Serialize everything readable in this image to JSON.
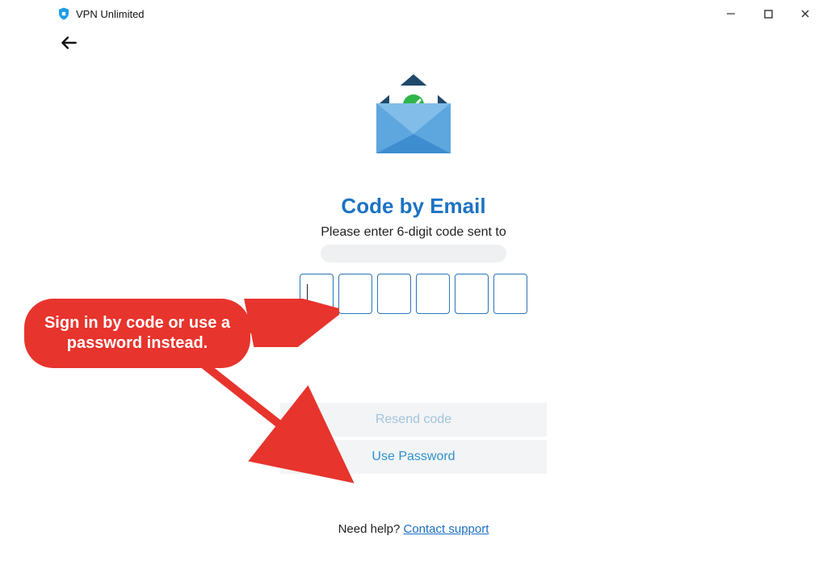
{
  "window": {
    "title": "VPN Unlimited"
  },
  "form": {
    "heading": "Code by Email",
    "subtext": "Please enter 6-digit code sent to",
    "code_values": [
      "",
      "",
      "",
      "",
      "",
      ""
    ],
    "resend_label": "Resend code",
    "password_label": "Use Password"
  },
  "footer": {
    "help_text": "Need help? ",
    "support_link": "Contact support"
  },
  "annotation": {
    "callout": "Sign in by code or use a password instead."
  }
}
